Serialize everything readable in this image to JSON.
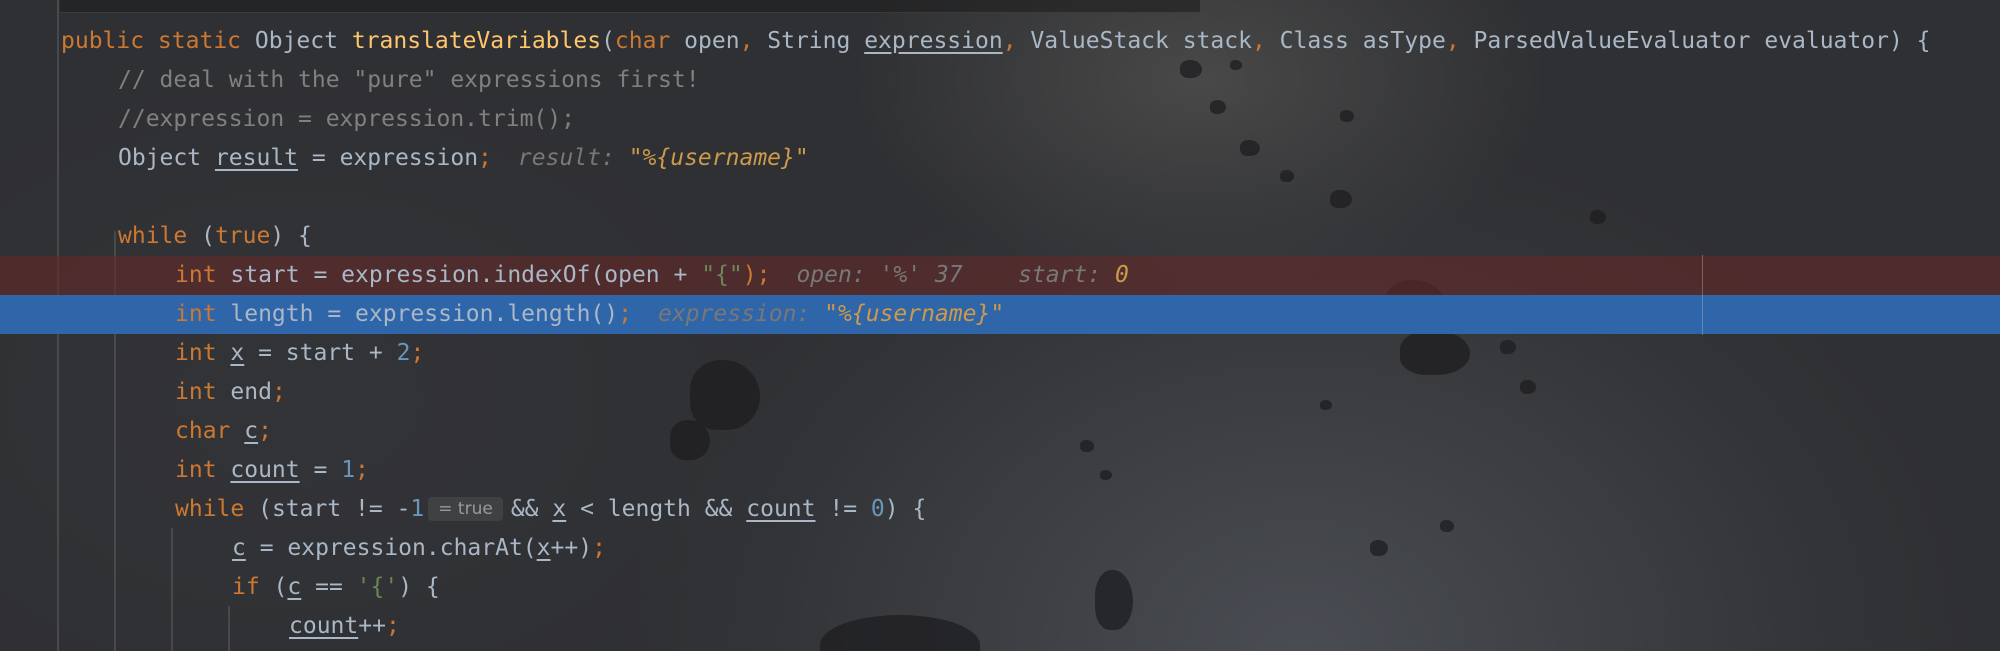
{
  "editor": {
    "lines": [
      {
        "indent": 0,
        "tokens": [
          {
            "t": "public static ",
            "c": "kw"
          },
          {
            "t": "Object ",
            "c": "plain"
          },
          {
            "t": "translateVariables",
            "c": "fn"
          },
          {
            "t": "(",
            "c": "plain"
          },
          {
            "t": "char ",
            "c": "kw"
          },
          {
            "t": "open",
            "c": "plain"
          },
          {
            "t": ", ",
            "c": "kw"
          },
          {
            "t": "String ",
            "c": "plain"
          },
          {
            "t": "expression",
            "c": "underline"
          },
          {
            "t": ", ",
            "c": "kw"
          },
          {
            "t": "ValueStack stack",
            "c": "plain"
          },
          {
            "t": ", ",
            "c": "kw"
          },
          {
            "t": "Class asType",
            "c": "plain"
          },
          {
            "t": ", ",
            "c": "kw"
          },
          {
            "t": "ParsedValueEvaluator evaluator) {",
            "c": "plain"
          }
        ]
      },
      {
        "indent": 1,
        "tokens": [
          {
            "t": "// deal with the \"pure\" expressions first!",
            "c": "cmt"
          }
        ]
      },
      {
        "indent": 1,
        "tokens": [
          {
            "t": "//expression = expression.trim();",
            "c": "cmt"
          }
        ]
      },
      {
        "indent": 1,
        "tokens": [
          {
            "t": "Object ",
            "c": "plain"
          },
          {
            "t": "result",
            "c": "underline"
          },
          {
            "t": " = expression",
            "c": "plain"
          },
          {
            "t": ";",
            "c": "kw"
          }
        ],
        "hint": {
          "label": "result:",
          "value": "\"%{username}\""
        }
      },
      {
        "indent": 1,
        "tokens": []
      },
      {
        "indent": 1,
        "tokens": [
          {
            "t": "while ",
            "c": "kw"
          },
          {
            "t": "(",
            "c": "plain"
          },
          {
            "t": "true",
            "c": "kw"
          },
          {
            "t": ") {",
            "c": "plain"
          }
        ]
      },
      {
        "indent": 2,
        "state": "breakpoint",
        "tokens": [
          {
            "t": "int ",
            "c": "kw"
          },
          {
            "t": "start = expression.indexOf(open + ",
            "c": "plain"
          },
          {
            "t": "\"{\"",
            "c": "str"
          },
          {
            "t": ");",
            "c": "kw"
          }
        ],
        "hint": {
          "label": "open: '%' 37",
          "label2": "start:",
          "value": "0"
        }
      },
      {
        "indent": 2,
        "state": "execution",
        "tokens": [
          {
            "t": "int ",
            "c": "kw"
          },
          {
            "t": "length = expression.length()",
            "c": "plain"
          },
          {
            "t": ";",
            "c": "kw"
          }
        ],
        "hint": {
          "label": "expression:",
          "value": "\"%{username}\""
        }
      },
      {
        "indent": 2,
        "tokens": [
          {
            "t": "int ",
            "c": "kw"
          },
          {
            "t": "x",
            "c": "underline"
          },
          {
            "t": " = start + ",
            "c": "plain"
          },
          {
            "t": "2",
            "c": "num"
          },
          {
            "t": ";",
            "c": "kw"
          }
        ]
      },
      {
        "indent": 2,
        "tokens": [
          {
            "t": "int ",
            "c": "kw"
          },
          {
            "t": "end",
            "c": "plain"
          },
          {
            "t": ";",
            "c": "kw"
          }
        ]
      },
      {
        "indent": 2,
        "tokens": [
          {
            "t": "char ",
            "c": "kw"
          },
          {
            "t": "c",
            "c": "underline"
          },
          {
            "t": ";",
            "c": "kw"
          }
        ]
      },
      {
        "indent": 2,
        "tokens": [
          {
            "t": "int ",
            "c": "kw"
          },
          {
            "t": "count",
            "c": "underline"
          },
          {
            "t": " = ",
            "c": "plain"
          },
          {
            "t": "1",
            "c": "num"
          },
          {
            "t": ";",
            "c": "kw"
          }
        ]
      },
      {
        "indent": 2,
        "tokens": [
          {
            "t": "while ",
            "c": "kw"
          },
          {
            "t": "(start != -",
            "c": "plain"
          },
          {
            "t": "1",
            "c": "num"
          },
          {
            "t": "= true",
            "c": "badge"
          },
          {
            "t": "&& ",
            "c": "plain"
          },
          {
            "t": "x",
            "c": "underline"
          },
          {
            "t": " < length && ",
            "c": "plain"
          },
          {
            "t": "count",
            "c": "underline"
          },
          {
            "t": " != ",
            "c": "plain"
          },
          {
            "t": "0",
            "c": "num"
          },
          {
            "t": ") {",
            "c": "plain"
          }
        ]
      },
      {
        "indent": 3,
        "tokens": [
          {
            "t": "c",
            "c": "underline"
          },
          {
            "t": " = expression.charAt(",
            "c": "plain"
          },
          {
            "t": "x",
            "c": "underline"
          },
          {
            "t": "++)",
            "c": "plain"
          },
          {
            "t": ";",
            "c": "kw"
          }
        ]
      },
      {
        "indent": 3,
        "tokens": [
          {
            "t": "if ",
            "c": "kw"
          },
          {
            "t": "(",
            "c": "plain"
          },
          {
            "t": "c",
            "c": "underline"
          },
          {
            "t": " == ",
            "c": "plain"
          },
          {
            "t": "'{'",
            "c": "str"
          },
          {
            "t": ") {",
            "c": "plain"
          }
        ]
      },
      {
        "indent": 4,
        "tokens": [
          {
            "t": "count",
            "c": "underline"
          },
          {
            "t": "++",
            "c": "plain"
          },
          {
            "t": ";",
            "c": "kw"
          }
        ]
      }
    ]
  },
  "colors": {
    "keyword": "#cc7832",
    "method": "#ffc66d",
    "string": "#6a8759",
    "number": "#6897bb",
    "comment": "#808080",
    "execution_line": "#2f65a9",
    "breakpoint_line": "#642828"
  }
}
